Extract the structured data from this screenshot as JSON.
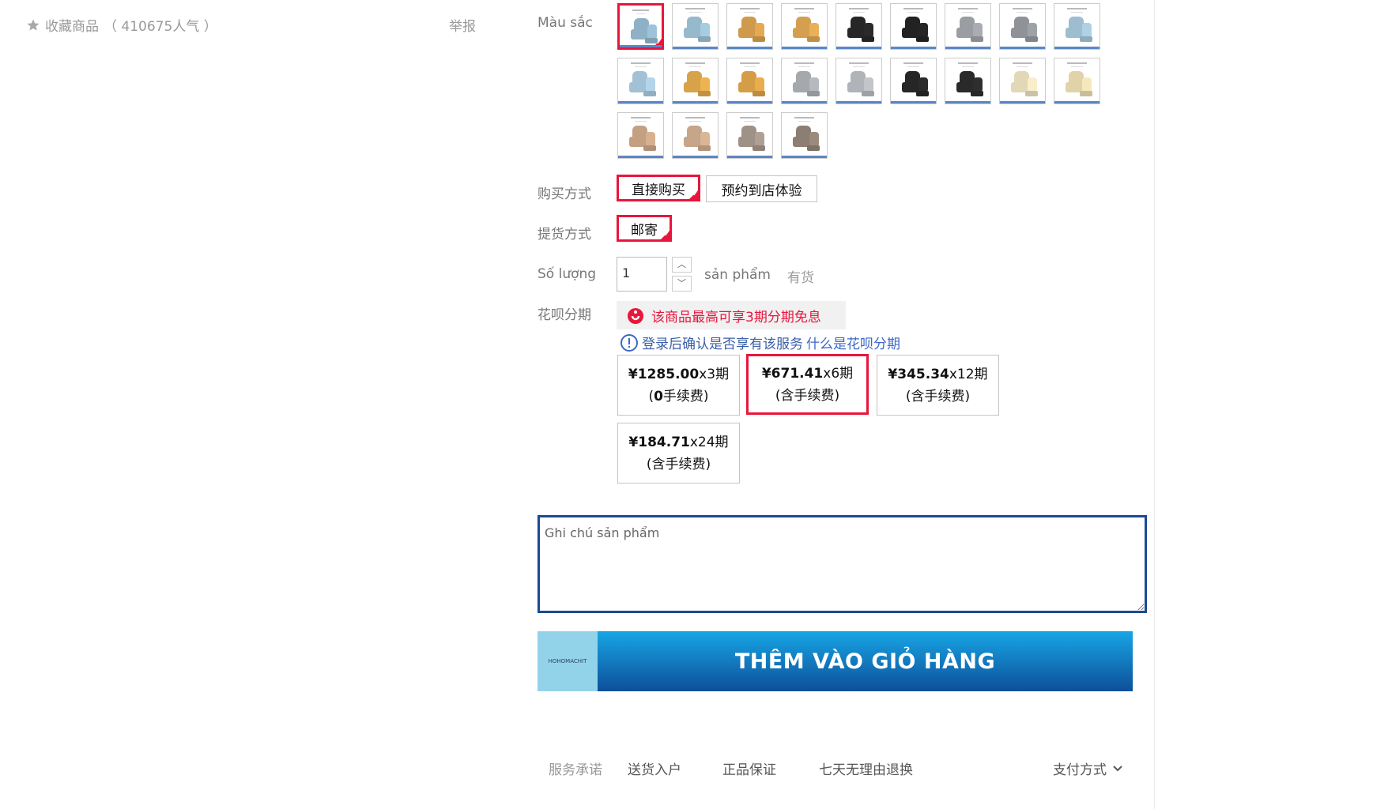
{
  "favorite": {
    "label": "收藏商品",
    "count": "（ 410675人气 ）"
  },
  "report_label": "举报",
  "labels": {
    "color": "Màu sắc",
    "purchase_method": "购买方式",
    "delivery_method": "提货方式",
    "quantity": "Số lượng",
    "installment": "花呗分期"
  },
  "swatch_colors": [
    "#8fb1c6",
    "#97b9cc",
    "#d09a4c",
    "#d4a050",
    "#262626",
    "#222222",
    "#9a9da1",
    "#8f9397",
    "#9fbdd0",
    "#a3c1d4",
    "#d8a24a",
    "#d49d46",
    "#a5a8ad",
    "#b0b3b8",
    "#262626",
    "#2a2a2a",
    "#e2d8b8",
    "#e0d3aa",
    "#c4a083",
    "#c6a589",
    "#9e9186",
    "#8c7e72"
  ],
  "selected_swatch": 0,
  "purchase_options": [
    {
      "label": "直接购买",
      "selected": true
    },
    {
      "label": "预约到店体验",
      "selected": false
    }
  ],
  "delivery_options": [
    {
      "label": "邮寄",
      "selected": true
    }
  ],
  "quantity": {
    "value": "1",
    "unit": "sản phẩm",
    "stock": "有货"
  },
  "promo_text": "该商品最高可享3期分期免息",
  "login_text": "登录后确认是否享有该服务",
  "login_link": "什么是花呗分期",
  "installments": [
    {
      "price": "¥1285.00",
      "periods": "x3期",
      "fee_open": "(",
      "fee_bold": "0",
      "fee_rest": "手续费)",
      "selected": false
    },
    {
      "price": "¥671.41",
      "periods": "x6期",
      "fee_open": "(",
      "fee_bold": "",
      "fee_rest": "含手续费)",
      "selected": true
    },
    {
      "price": "¥345.34",
      "periods": "x12期",
      "fee_open": "(",
      "fee_bold": "",
      "fee_rest": "含手续费)",
      "selected": false
    },
    {
      "price": "¥184.71",
      "periods": "x24期",
      "fee_open": "(",
      "fee_bold": "",
      "fee_rest": "含手续费)",
      "selected": false
    }
  ],
  "note_placeholder": "Ghi chú sản phẩm",
  "cart": {
    "label": "THÊM VÀO GIỎ HÀNG",
    "logo_text": "HOHOMACHIT"
  },
  "services": {
    "label": "服务承诺",
    "items": [
      "送货入户",
      "正品保证",
      "七天无理由退换"
    ]
  },
  "payment_label": "支付方式"
}
